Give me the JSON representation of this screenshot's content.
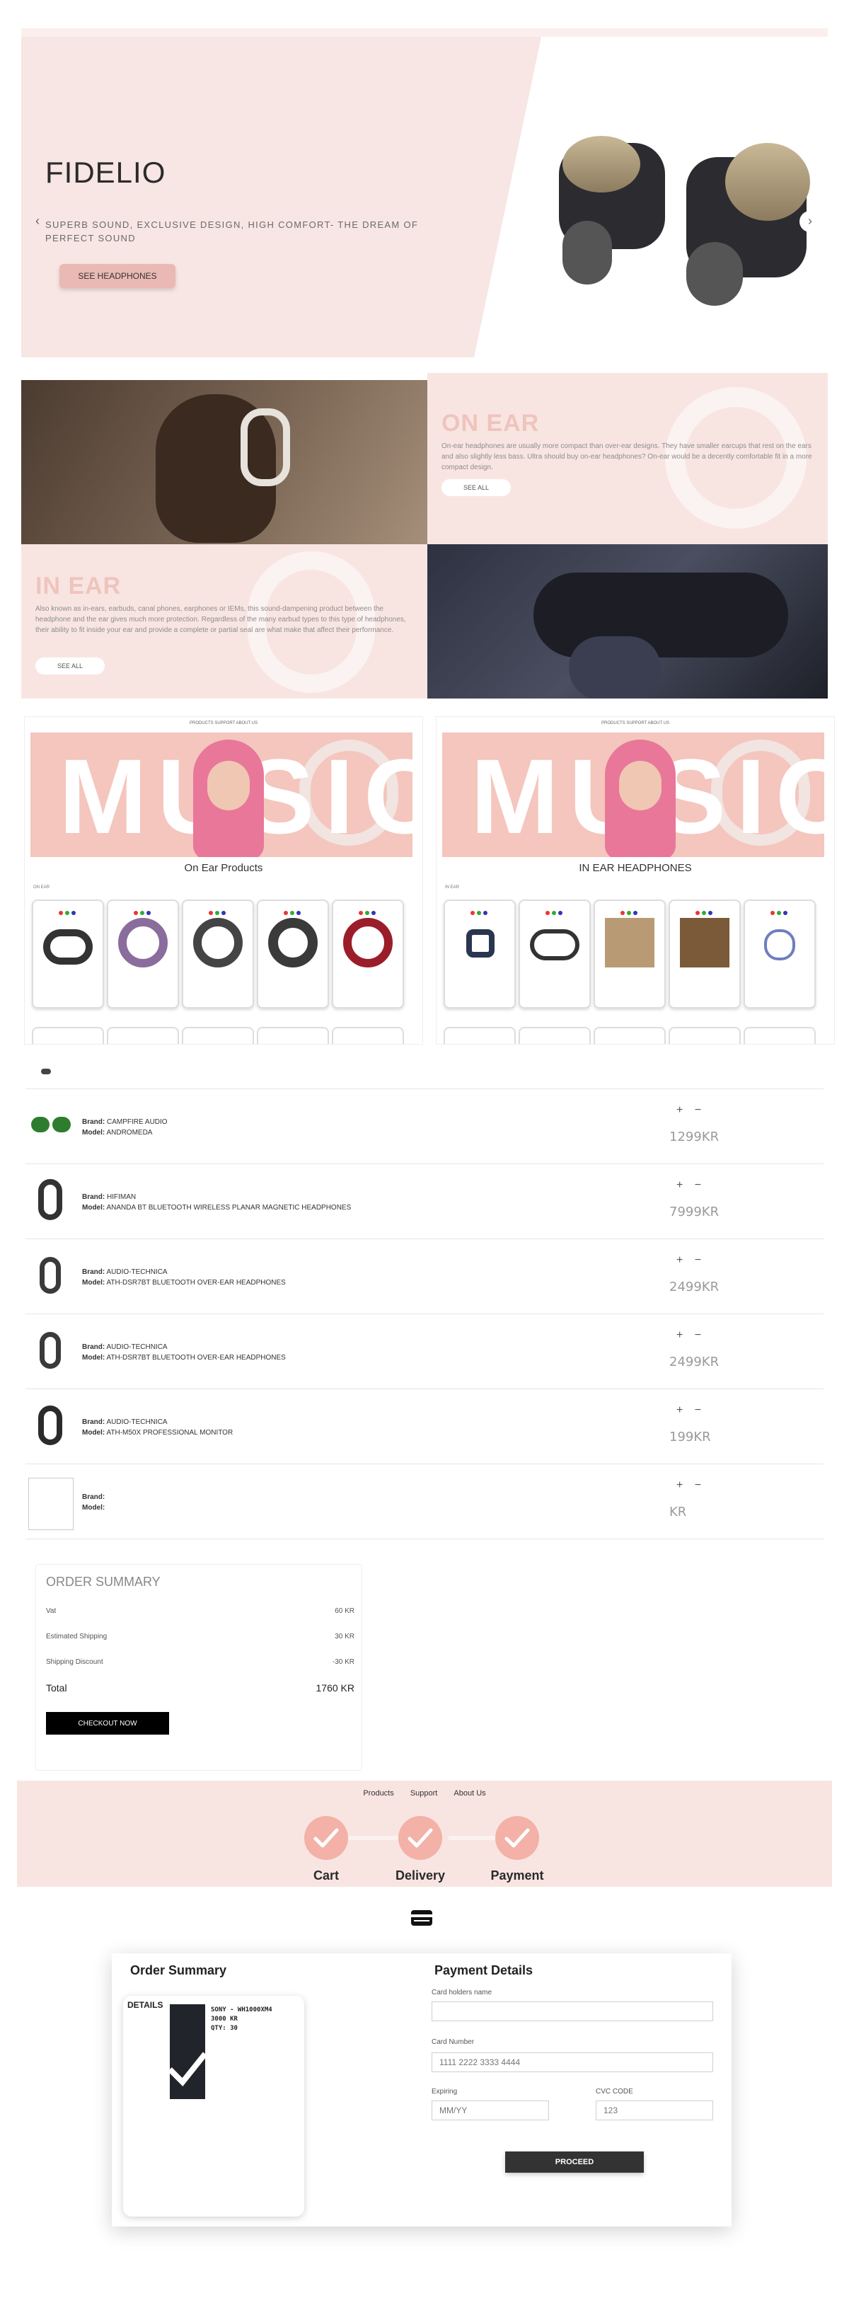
{
  "hero": {
    "title": "FIDELIO",
    "subtitle": "SUPERB SOUND, EXCLUSIVE DESIGN, HIGH COMFORT- THE DREAM OF PERFECT SOUND",
    "button": "SEE HEADPHONES",
    "arrow_left": "‹",
    "arrow_right": "›"
  },
  "categories": {
    "on_ear": {
      "title": "ON EAR",
      "text": "On-ear headphones are usually more compact than over-ear designs. They have smaller earcups that rest on the ears and also slightly less bass. Ultra should buy on-ear headphones? On-ear would be a decently comfortable fit in a more compact design.",
      "button": "SEE ALL"
    },
    "in_ear": {
      "title": "IN EAR",
      "text": "Also known as in-ears, earbuds, canal phones, earphones or IEMs, this sound-dampening product between the headphone and the ear gives much more protection. Regardless of the many earbud types to this type of headphones, their ability to fit inside your ear and provide a complete or partial seal are what make that affect their performance.",
      "button": "SEE ALL"
    }
  },
  "previews": [
    {
      "word": "MUSIC",
      "heading": "On Ear Products",
      "label": "ON EAR",
      "nav": "PRODUCTS   SUPPORT   ABOUT US"
    },
    {
      "word": "MUSIC",
      "heading": "IN EAR HEADPHONES",
      "label": "IN EAR",
      "nav": "PRODUCTS   SUPPORT   ABOUT US"
    }
  ],
  "cart": {
    "brand_label": "Brand:",
    "model_label": "Model:",
    "controls": "+ −",
    "items": [
      {
        "brand": "CAMPFIRE AUDIO",
        "model": "ANDROMEDA",
        "price": "1299KR"
      },
      {
        "brand": "HIFIMAN",
        "model": "ANANDA BT BLUETOOTH WIRELESS PLANAR MAGNETIC HEADPHONES",
        "price": "7999KR"
      },
      {
        "brand": "AUDIO-TECHNICA",
        "model": "ATH-DSR7BT BLUETOOTH OVER-EAR HEADPHONES",
        "price": "2499KR"
      },
      {
        "brand": "AUDIO-TECHNICA",
        "model": "ATH-DSR7BT BLUETOOTH OVER-EAR HEADPHONES",
        "price": "2499KR"
      },
      {
        "brand": "AUDIO-TECHNICA",
        "model": "ATH-M50X PROFESSIONAL MONITOR",
        "price": "199KR"
      },
      {
        "brand": "",
        "model": "",
        "price": "KR"
      }
    ]
  },
  "summary": {
    "title": "ORDER SUMMARY",
    "vat_label": "Vat",
    "vat_value": "60 KR",
    "shipping_label": "Estimated Shipping",
    "shipping_value": "30 KR",
    "discount_label": "Shipping Discount",
    "discount_value": "-30 KR",
    "total_label": "Total",
    "total_value": "1760 KR",
    "button": "CHECKOUT NOW"
  },
  "steps": {
    "nav": [
      "Products",
      "Support",
      "About Us"
    ],
    "labels": [
      "Cart",
      "Delivery",
      "Payment"
    ]
  },
  "payment": {
    "order_title": "Order Summary",
    "details_label": "DETAILS",
    "item_name": "SONY - WH1000XM4",
    "item_price": "3000 KR",
    "item_qty": "QTY: 30",
    "pay_title": "Payment Details",
    "card_holder_label": "Card holders name",
    "card_number_label": "Card Number",
    "card_number_placeholder": "1111 2222 3333 4444",
    "expiry_label": "Expiring",
    "expiry_placeholder": "MM/YY",
    "cvc_label": "CVC CODE",
    "cvc_placeholder": "123",
    "button": "PROCEED"
  }
}
